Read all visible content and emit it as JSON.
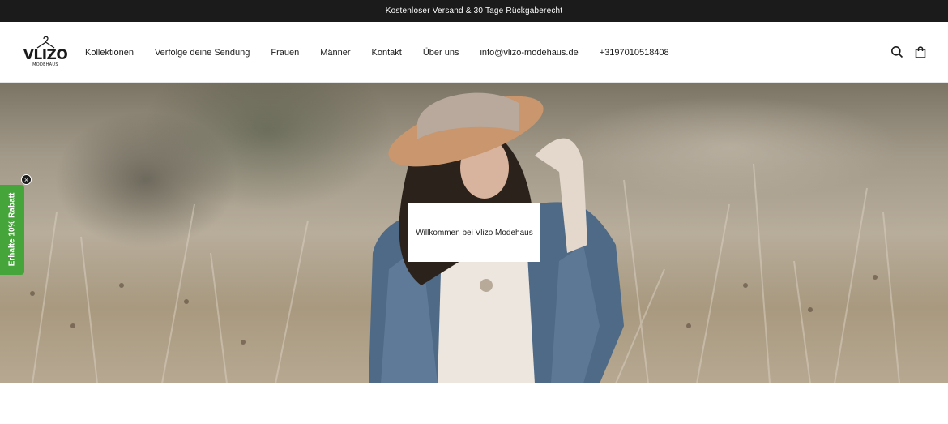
{
  "announcement": {
    "text": "Kostenloser Versand & 30 Tage Rückgaberecht"
  },
  "header": {
    "logo": {
      "word": "VLIZO",
      "sub": "MODEHAUS"
    },
    "nav": [
      {
        "label": "Kollektionen"
      },
      {
        "label": "Verfolge deine Sendung"
      },
      {
        "label": "Frauen"
      },
      {
        "label": "Männer"
      },
      {
        "label": "Kontakt"
      },
      {
        "label": "Über uns"
      },
      {
        "label": "info@vlizo-modehaus.de"
      },
      {
        "label": "+3197010518408"
      }
    ],
    "icons": {
      "search": "search-icon",
      "cart": "shopping-bag-icon"
    }
  },
  "hero": {
    "welcome": "Willkommen bei Vlizo Modehaus"
  },
  "promo": {
    "label": "Erhalte 10% Rabatt",
    "close": "×"
  },
  "colors": {
    "topbar": "#1c1b1b",
    "promo": "#45a53a",
    "text": "#1c1b1b"
  }
}
